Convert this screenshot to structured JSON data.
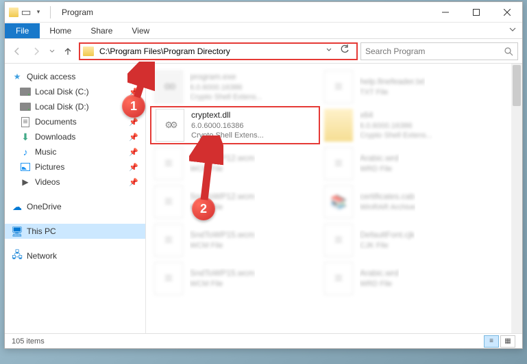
{
  "window": {
    "title": "Program",
    "ribbon": {
      "file": "File",
      "home": "Home",
      "share": "Share",
      "view": "View"
    },
    "address": "C:\\Program Files\\Program Directory",
    "search_placeholder": "Search Program",
    "status": "105 items"
  },
  "sidebar": {
    "quick_access": "Quick access",
    "items": [
      {
        "label": "Local Disk (C:)"
      },
      {
        "label": "Local Disk (D:)"
      },
      {
        "label": "Documents"
      },
      {
        "label": "Downloads"
      },
      {
        "label": "Music"
      },
      {
        "label": "Pictures"
      },
      {
        "label": "Videos"
      }
    ],
    "onedrive": "OneDrive",
    "thispc": "This PC",
    "network": "Network"
  },
  "files": [
    {
      "name": "program.exe",
      "line2": "6.0.6000.16386",
      "line3": "Crypto Shell Extens...",
      "kind": "exe",
      "blur": true
    },
    {
      "name": "help.finefeader.txt",
      "line2": "TXT File",
      "line3": "",
      "kind": "txt",
      "blur": true
    },
    {
      "name": "cryptext.dll",
      "line2": "6.0.6000.16386",
      "line3": "Crypto Shell Extens...",
      "kind": "dll",
      "blur": false,
      "highlight": true
    },
    {
      "name": "x64",
      "line2": "6.0.6000.16386",
      "line3": "Crypto Shell Extens...",
      "kind": "folder",
      "blur": true
    },
    {
      "name": "SndToWP12.wcm",
      "line2": "WCM File",
      "line3": "",
      "kind": "txt",
      "blur": true
    },
    {
      "name": "Arabic.wrd",
      "line2": "WRD File",
      "line3": "",
      "kind": "txt",
      "blur": true
    },
    {
      "name": "SndToWP12.wcm",
      "line2": "WCM File",
      "line3": "",
      "kind": "txt",
      "blur": true
    },
    {
      "name": "certificates.cab",
      "line2": "WinRAR Archive",
      "line3": "",
      "kind": "rar",
      "blur": true
    },
    {
      "name": "SndToWP15.wcm",
      "line2": "WCM File",
      "line3": "",
      "kind": "txt",
      "blur": true
    },
    {
      "name": "DefaultFont.cjk",
      "line2": "CJK File",
      "line3": "",
      "kind": "txt",
      "blur": true
    },
    {
      "name": "SndToWP15.wcm",
      "line2": "WCM File",
      "line3": "",
      "kind": "txt",
      "blur": true
    },
    {
      "name": "Arabic.wrd",
      "line2": "WRD File",
      "line3": "",
      "kind": "txt",
      "blur": true
    }
  ],
  "annotations": {
    "one": "1",
    "two": "2"
  }
}
